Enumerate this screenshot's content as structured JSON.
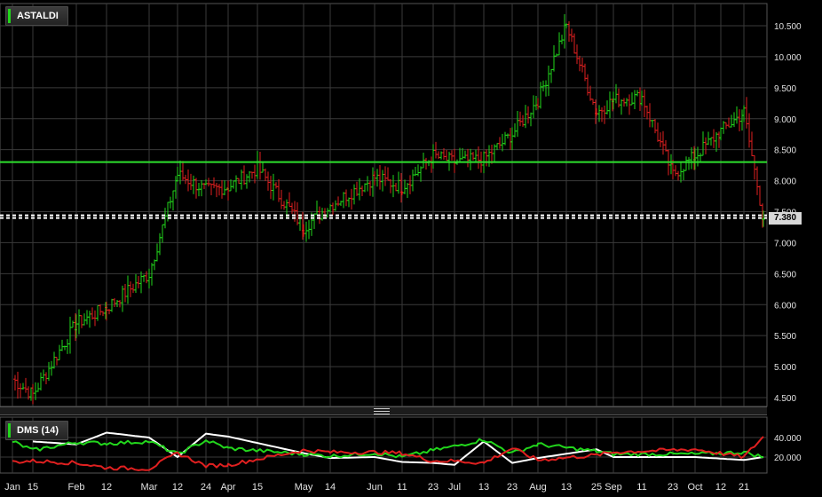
{
  "instrument": "ASTALDI",
  "indicator_label": "DMS (14)",
  "last_price_label": "7.380",
  "colors": {
    "up": "#22d61c",
    "down": "#e02020",
    "grid": "#3a3a3a",
    "support": "#2ee02e",
    "last": "#ffffff",
    "adx": "#ffffff",
    "dmi_plus": "#22d61c",
    "dmi_minus": "#e02020",
    "text": "#e0e0e0"
  },
  "chart_data": [
    {
      "type": "ohlc",
      "title": "ASTALDI",
      "xlabel": "",
      "ylabel": "",
      "x_tick_labels": [
        "Jan",
        "15",
        "Feb",
        "12",
        "Mar",
        "12",
        "24",
        "Apr",
        "15",
        "May",
        "14",
        "Jun",
        "11",
        "23",
        "Jul",
        "13",
        "23",
        "Aug",
        "13",
        "25",
        "Sep",
        "11",
        "23",
        "Oct",
        "12",
        "21"
      ],
      "y_ticks": [
        "4.500",
        "5.000",
        "5.500",
        "6.000",
        "6.500",
        "7.000",
        "7.500",
        "8.000",
        "8.500",
        "9.000",
        "9.500",
        "10.000",
        "10.500"
      ],
      "ylim": [
        4.4,
        10.9
      ],
      "grid": true,
      "horizontal_lines": [
        {
          "value": 8.3,
          "style": "solid",
          "color": "#2ee02e"
        },
        {
          "value": 7.42,
          "style": "dashed",
          "color": "#ffffff"
        }
      ],
      "close_path": [
        [
          "Jan",
          4.8
        ],
        [
          "15",
          4.55
        ],
        [
          "Feb",
          5.7
        ],
        [
          "12",
          5.95
        ],
        [
          "Mar",
          6.5
        ],
        [
          "12",
          8.1
        ],
        [
          "24",
          7.85
        ],
        [
          "Apr",
          7.9
        ],
        [
          "15",
          8.2
        ],
        [
          "May",
          7.25
        ],
        [
          "14",
          7.6
        ],
        [
          "Jun",
          8.05
        ],
        [
          "11",
          7.9
        ],
        [
          "23",
          8.4
        ],
        [
          "Jul",
          8.3
        ],
        [
          "13",
          8.35
        ],
        [
          "23",
          8.75
        ],
        [
          "Aug",
          9.3
        ],
        [
          "13",
          10.5
        ],
        [
          "25",
          9.1
        ],
        [
          "Sep",
          9.3
        ],
        [
          "11",
          9.35
        ],
        [
          "23",
          8.1
        ],
        [
          "Oct",
          8.4
        ],
        [
          "12",
          8.8
        ],
        [
          "21",
          9.1
        ],
        [
          "end",
          7.38
        ]
      ]
    },
    {
      "type": "line",
      "title": "DMS (14)",
      "y_ticks": [
        "20.000",
        "40.000"
      ],
      "ylim": [
        0,
        50
      ],
      "series": [
        {
          "color": "#ffffff",
          "points": [
            [
              "Feb",
              33
            ],
            [
              "Mar",
              40
            ],
            [
              "12",
              45
            ],
            [
              "24",
              44
            ],
            [
              "Apr",
              41
            ],
            [
              "15",
              36
            ],
            [
              "May",
              24
            ],
            [
              "14",
              19
            ],
            [
              "Jun",
              20
            ],
            [
              "11",
              15
            ],
            [
              "Jul",
              12
            ],
            [
              "23",
              14
            ],
            [
              "Aug",
              19
            ],
            [
              "13",
              36
            ],
            [
              "25",
              28
            ],
            [
              "Sep",
              20
            ],
            [
              "23",
              14
            ],
            [
              "Oct",
              20
            ],
            [
              "12",
              20
            ],
            [
              "21",
              17
            ],
            [
              "end",
              20
            ]
          ]
        },
        {
          "color": "#22d61c",
          "points": [
            [
              "Jan",
              36
            ],
            [
              "Feb",
              35
            ],
            [
              "Mar",
              36
            ],
            [
              "12",
              34
            ],
            [
              "24",
              37
            ],
            [
              "Apr",
              29
            ],
            [
              "15",
              27
            ],
            [
              "May",
              23
            ],
            [
              "14",
              21
            ],
            [
              "Jun",
              24
            ],
            [
              "11",
              20
            ],
            [
              "Jul",
              31
            ],
            [
              "23",
              27
            ],
            [
              "Aug",
              33
            ],
            [
              "13",
              38
            ],
            [
              "25",
              26
            ],
            [
              "Sep",
              23
            ],
            [
              "23",
              24
            ],
            [
              "Oct",
              23
            ],
            [
              "12",
              23
            ],
            [
              "21",
              25
            ],
            [
              "end",
              20
            ]
          ]
        },
        {
          "color": "#e02020",
          "points": [
            [
              "Jan",
              15
            ],
            [
              "Feb",
              14
            ],
            [
              "Mar",
              8
            ],
            [
              "12",
              9
            ],
            [
              "24",
              11
            ],
            [
              "Apr",
              12
            ],
            [
              "15",
              16
            ],
            [
              "May",
              27
            ],
            [
              "14",
              25
            ],
            [
              "Jun",
              25
            ],
            [
              "11",
              24
            ],
            [
              "Jul",
              16
            ],
            [
              "23",
              16
            ],
            [
              "Aug",
              17
            ],
            [
              "13",
              14
            ],
            [
              "25",
              22
            ],
            [
              "Sep",
              25
            ],
            [
              "23",
              29
            ],
            [
              "Oct",
              28
            ],
            [
              "12",
              24
            ],
            [
              "21",
              20
            ],
            [
              "end",
              41
            ]
          ]
        }
      ]
    }
  ]
}
